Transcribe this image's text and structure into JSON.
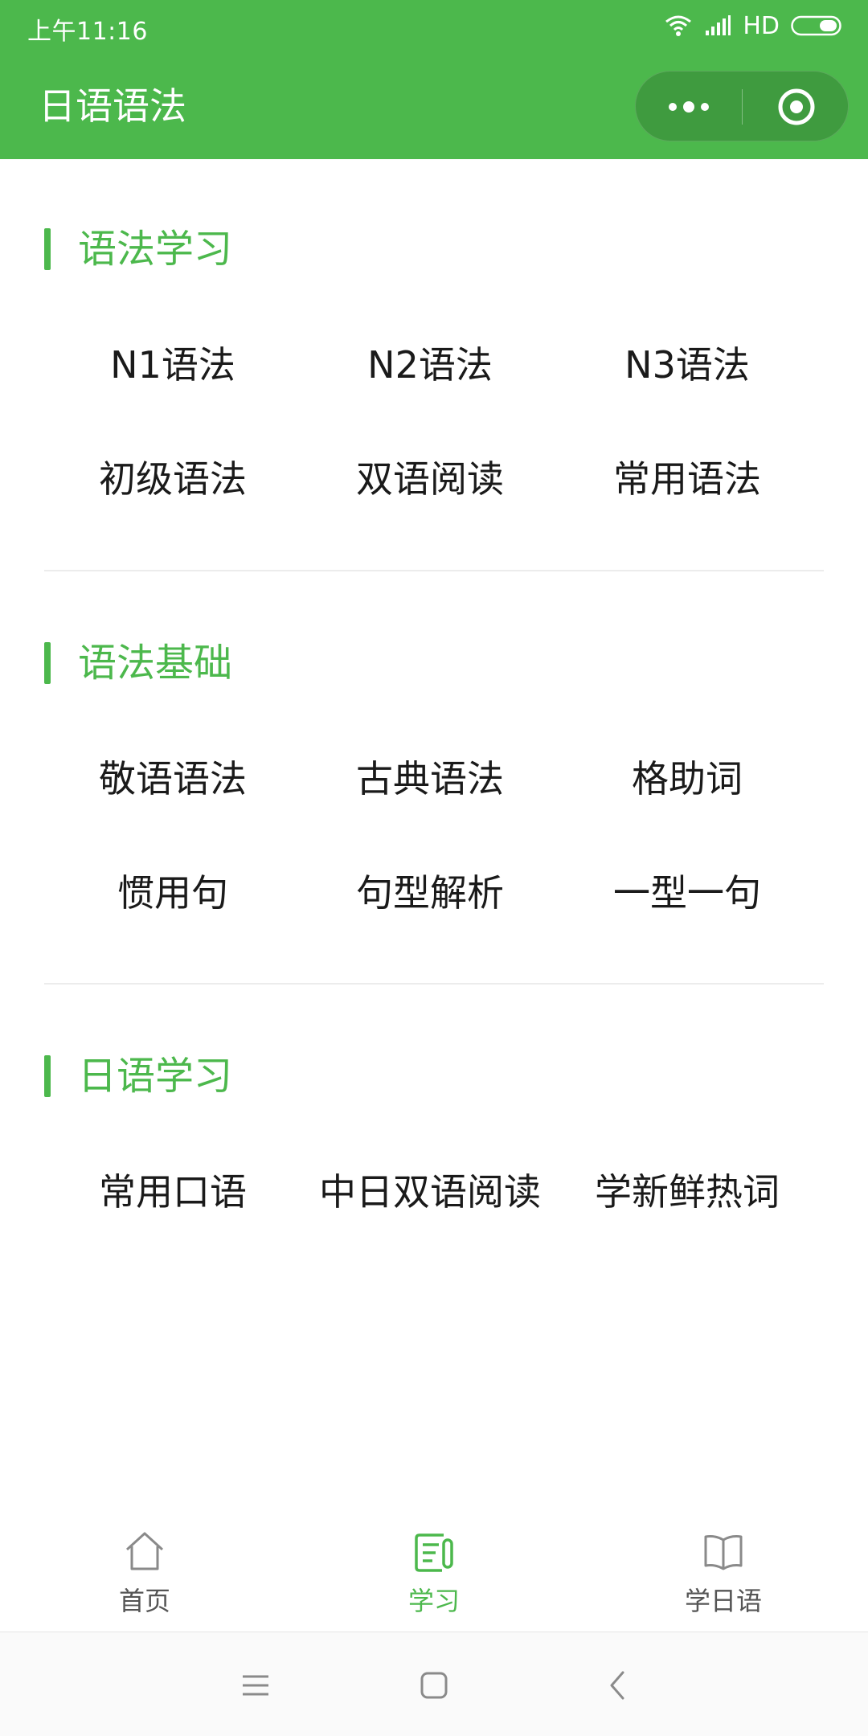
{
  "status_bar": {
    "time": "上午11:16",
    "network": "HD"
  },
  "nav": {
    "title": "日语语法"
  },
  "sections": [
    {
      "title": "语法学习",
      "items": [
        "N1语法",
        "N2语法",
        "N3语法",
        "初级语法",
        "双语阅读",
        "常用语法"
      ]
    },
    {
      "title": "语法基础",
      "items": [
        "敬语语法",
        "古典语法",
        "格助词",
        "惯用句",
        "句型解析",
        "一型一句"
      ]
    },
    {
      "title": "日语学习",
      "items": [
        "常用口语",
        "中日双语阅读",
        "学新鲜热词"
      ]
    }
  ],
  "tabs": [
    {
      "label": "首页",
      "icon": "home-icon",
      "active": false
    },
    {
      "label": "学习",
      "icon": "notes-icon",
      "active": true
    },
    {
      "label": "学日语",
      "icon": "book-icon",
      "active": false
    }
  ],
  "colors": {
    "brand_green": "#4cb84c",
    "capsule_green": "#3f9b3f",
    "text": "#1a1a1a",
    "tab_inactive": "#555555"
  }
}
